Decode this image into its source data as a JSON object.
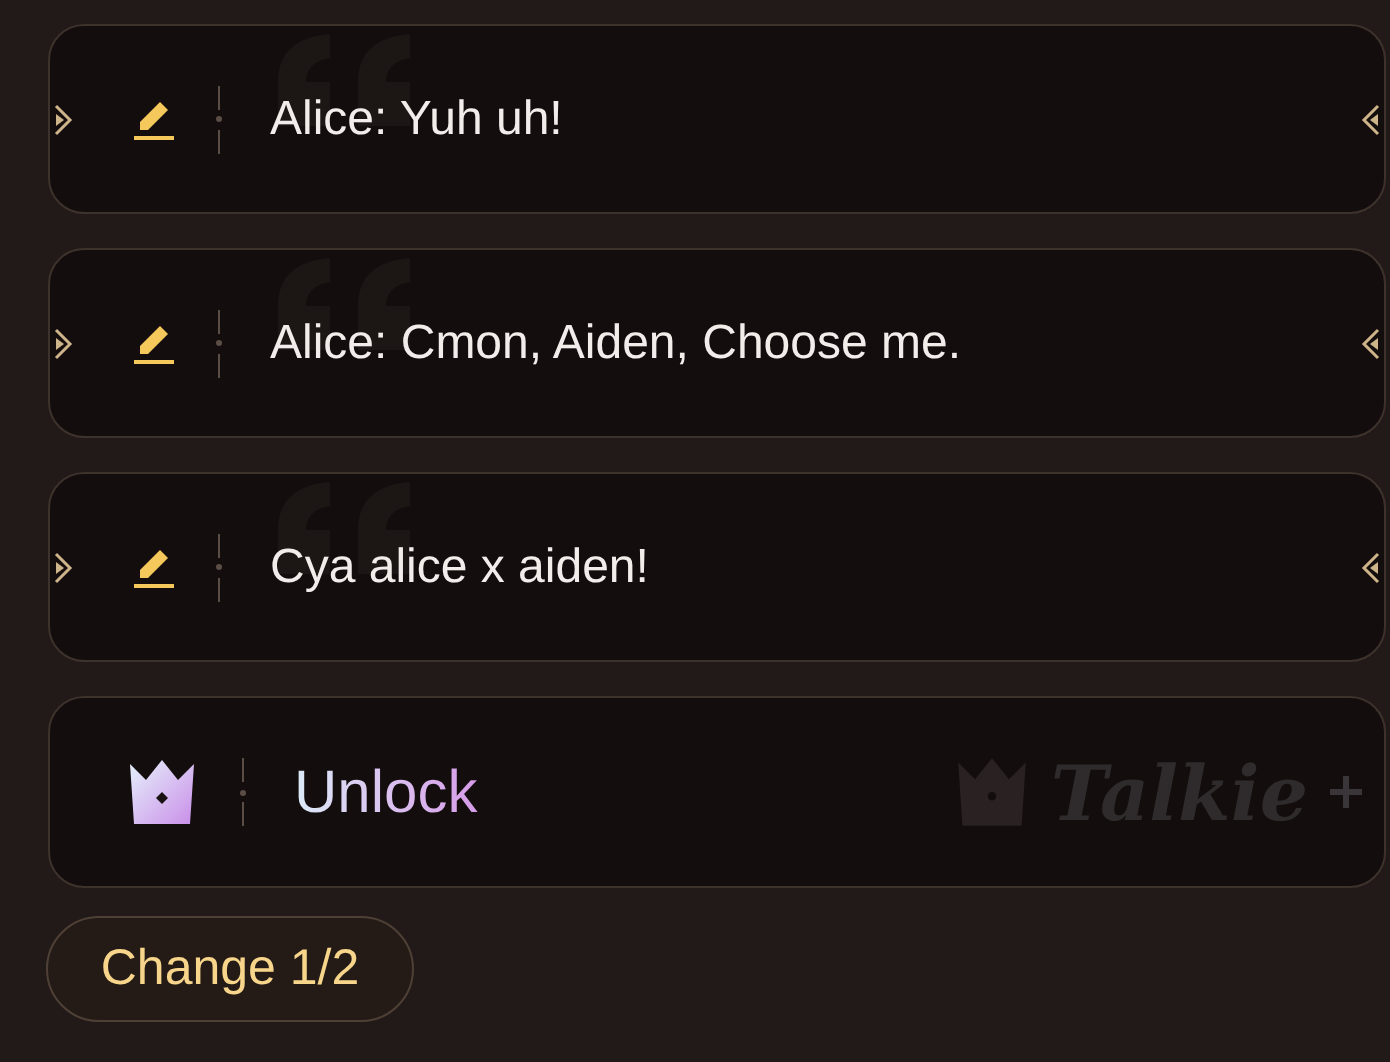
{
  "messages": [
    {
      "text": "Alice: Yuh uh!"
    },
    {
      "text": "Alice: Cmon, Aiden, Choose me."
    },
    {
      "text": "Cya alice x aiden!"
    }
  ],
  "unlock": {
    "label": "Unlock",
    "brand": "Talkie"
  },
  "change_button": {
    "label": "Change 1/2"
  }
}
